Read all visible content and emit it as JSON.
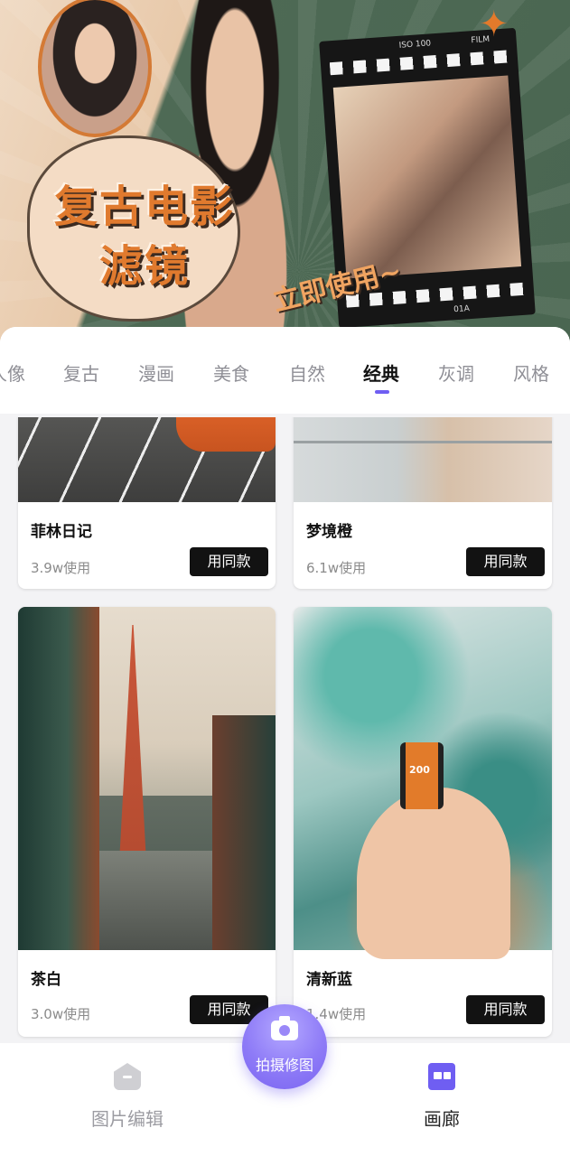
{
  "banner": {
    "title_line1": "复古电影",
    "title_line2": "滤镜",
    "slogan": "立即使用~",
    "film_label_iso": "ISO 100",
    "film_label_film": "FILM",
    "film_label_frame": "01A"
  },
  "tabs": {
    "items": [
      "人像",
      "复古",
      "漫画",
      "美食",
      "自然",
      "经典",
      "灰调",
      "风格"
    ],
    "active": "经典",
    "accent_color": "#6f5ef2"
  },
  "cards": [
    {
      "name": "菲林日记",
      "uses": "3.9w使用",
      "button": "用同款"
    },
    {
      "name": "梦境橙",
      "uses": "6.1w使用",
      "button": "用同款"
    },
    {
      "name": "茶白",
      "uses": "3.0w使用",
      "button": "用同款"
    },
    {
      "name": "清新蓝",
      "uses": "1.4w使用",
      "button": "用同款",
      "film_text": "200"
    }
  ],
  "capture": {
    "label": "拍摄修图",
    "icon": "camera-icon"
  },
  "bottom_nav": {
    "items": [
      {
        "label": "图片编辑",
        "icon": "photo-edit-icon",
        "active": false
      },
      {
        "label": "画廊",
        "icon": "gallery-icon",
        "active": true
      }
    ]
  }
}
